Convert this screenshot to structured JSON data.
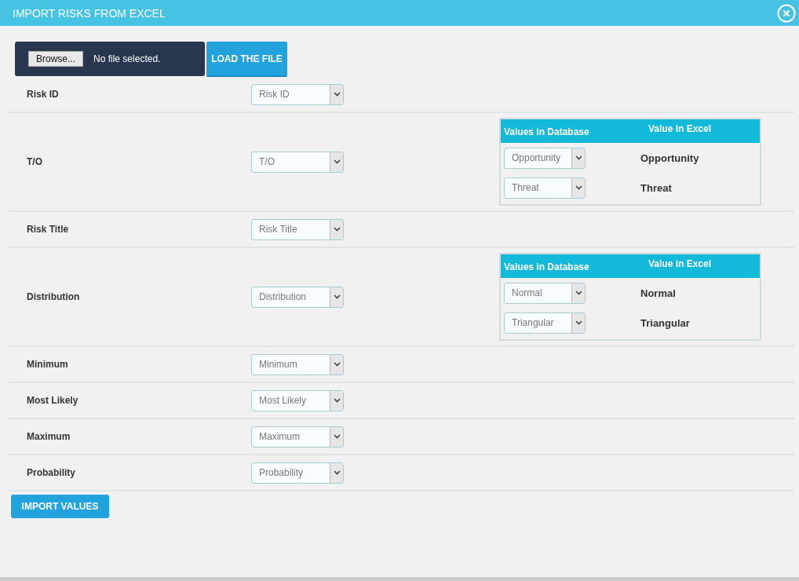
{
  "dialog": {
    "title": "IMPORT RISKS FROM EXCEL"
  },
  "file_picker": {
    "browse_label": "Browse...",
    "status": "No file selected."
  },
  "load_button": "LOAD THE FILE",
  "fields": [
    {
      "label": "Risk ID",
      "value": "Risk ID"
    },
    {
      "label": "T/O",
      "value": "T/O",
      "mapping": {
        "columns": [
          "Values in Database",
          "Value in Excel"
        ],
        "rows": [
          {
            "database": "Opportunity",
            "excel": "Opportunity"
          },
          {
            "database": "Threat",
            "excel": "Threat"
          }
        ]
      }
    },
    {
      "label": "Risk Title",
      "value": "Risk Title"
    },
    {
      "label": "Distribution",
      "value": "Distribution",
      "mapping": {
        "columns": [
          "Values in Database",
          "Value in Excel"
        ],
        "rows": [
          {
            "database": "Normal",
            "excel": "Normal"
          },
          {
            "database": "Triangular",
            "excel": "Triangular"
          }
        ]
      }
    },
    {
      "label": "Minimum",
      "value": "Minimum"
    },
    {
      "label": "Most Likely",
      "value": "Most Likely"
    },
    {
      "label": "Maximum",
      "value": "Maximum"
    },
    {
      "label": "Probability",
      "value": "Probability"
    }
  ],
  "import_button": "IMPORT VALUES"
}
